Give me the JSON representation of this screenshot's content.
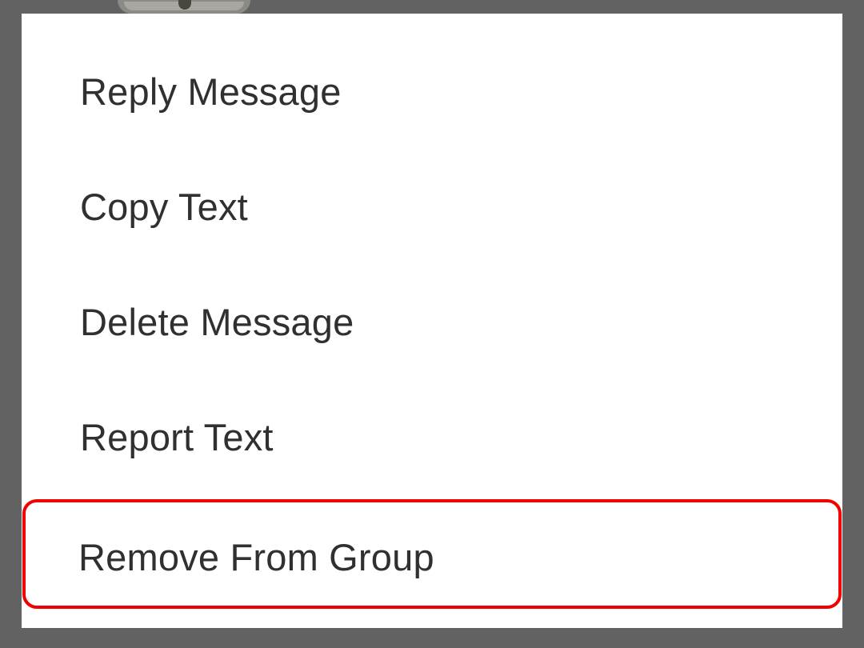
{
  "context_menu": {
    "items": [
      {
        "label": "Reply Message"
      },
      {
        "label": "Copy Text"
      },
      {
        "label": "Delete Message"
      },
      {
        "label": "Report Text"
      },
      {
        "label": "Remove From Group"
      }
    ],
    "highlighted_item_index": 4
  },
  "colors": {
    "backdrop": "#626262",
    "menu_background": "#ffffff",
    "text": "#303030",
    "highlight_border": "#f20000"
  }
}
